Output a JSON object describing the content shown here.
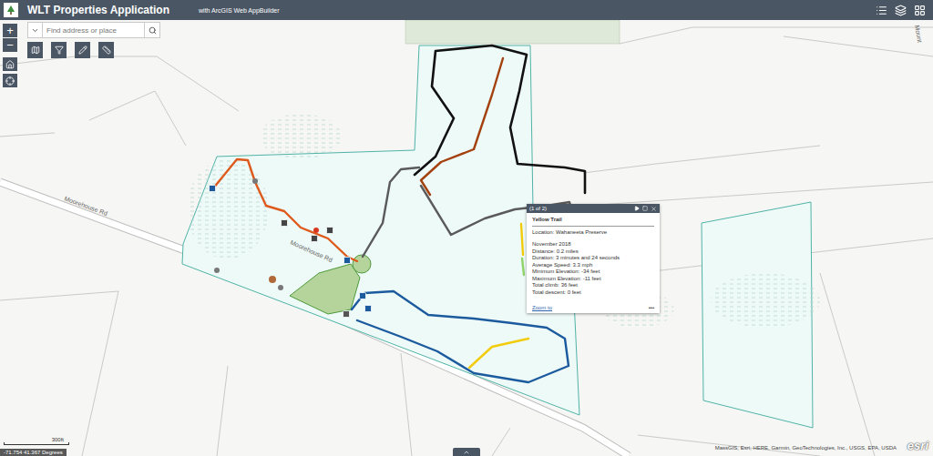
{
  "header": {
    "title": "WLT Properties Application",
    "subtitle": "with ArcGIS Web AppBuilder"
  },
  "search": {
    "placeholder": "Find address or place"
  },
  "zoom": {
    "in": "+",
    "out": "−"
  },
  "road_labels": [
    "Moorehouse Rd",
    "Moorehouse Rd",
    "Mount"
  ],
  "trails": [
    {
      "color": "#de5a1c"
    },
    {
      "color": "#111111"
    },
    {
      "color": "#a3410f"
    },
    {
      "color": "#5a5a5a"
    },
    {
      "color": "#f2cc0c"
    },
    {
      "color": "#8fd46a"
    },
    {
      "color": "#1c5a9e"
    }
  ],
  "popup": {
    "counter": "(1 of 2)",
    "title": "Yellow Trail",
    "location": "Location: Wahaneeta Preserve",
    "details": [
      "November 2018",
      "Distance: 0.2 miles",
      "Duration: 3 minutes and 24 seconds",
      "Average Speed: 3.3 mph",
      "Minimum Elevation: -34 feet",
      "Maximum Elevation: -11 feet",
      "Total climb: 36 feet",
      "Total descent: 0 feet"
    ],
    "link": "Zoom to",
    "more": "•••"
  },
  "scale": {
    "label": "300ft"
  },
  "coordinates": "-71.754 41.367 Degrees",
  "attribution": "MassGIS, Esri, HERE, Garmin, GeoTechnologies, Inc., USGS, EPA, USDA",
  "logo": "esri"
}
